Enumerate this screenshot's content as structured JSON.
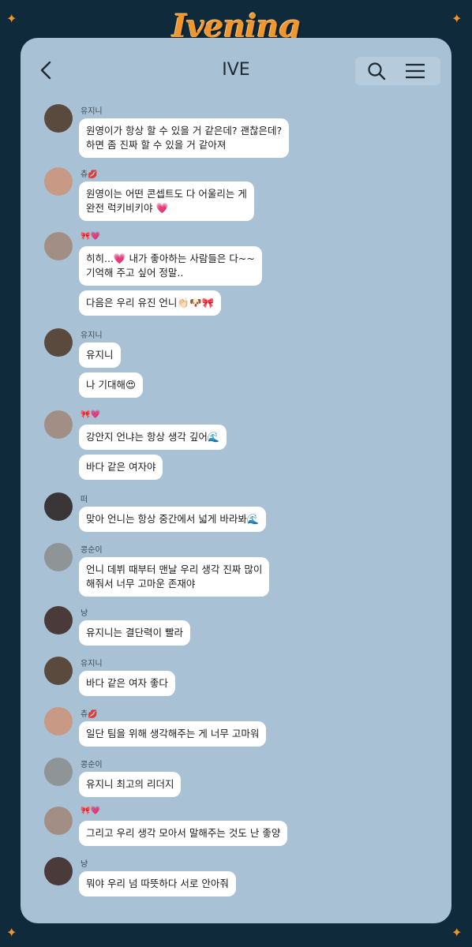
{
  "brand": {
    "logo_text": "Ivening"
  },
  "header": {
    "title": "IVE"
  },
  "icons": {
    "back": "chevron-left-icon",
    "search": "search-icon",
    "menu": "hamburger-menu-icon",
    "sparkle": "four-point-star-icon"
  },
  "colors": {
    "background": "#0f2a3a",
    "panel": "#a8c1d5",
    "accent": "#f0962f",
    "bubble": "#ffffff"
  },
  "messages": [
    {
      "sender": "유지니",
      "avatar_color": "#5a4a3e",
      "lines": [
        "원영이가 항상 할 수 있을 거 같은데? 괜찮은데?",
        "하면 좀 진짜 할 수 있을 거 같아져"
      ]
    },
    {
      "sender": "츄💋",
      "avatar_color": "#c89a86",
      "lines": [
        "원영이는 어떤 콘셉트도 다 어울리는 게",
        "완전 럭키비키야 💗"
      ]
    },
    {
      "sender": "🎀💗",
      "avatar_color": "#a38e86",
      "lines": [
        "히히...💗 내가 좋아하는 사람들은 다~~",
        "기억해 주고 싶어 정말.."
      ],
      "extra": "다음은 우리 유진 언니👏🏻🐶🎀"
    },
    {
      "sender": "유지니",
      "avatar_color": "#5a4a3e",
      "lines": [
        "유지니"
      ],
      "extra": "나 기대해😍"
    },
    {
      "sender": "🎀💗",
      "avatar_color": "#a38e86",
      "lines": [
        "강안지 언냐는 항상 생각 깊어🌊"
      ],
      "extra": "바다 같은 여자야"
    },
    {
      "sender": "떠",
      "avatar_color": "#3a3638",
      "lines": [
        "맞아 언니는 항상 중간에서 넓게 바라봐🌊"
      ]
    },
    {
      "sender": "콩순이",
      "avatar_color": "#8f9496",
      "lines": [
        "언니 데뷔 때부터 맨날 우리 생각 진짜 많이",
        "해줘서 너무 고마운 존재야"
      ]
    },
    {
      "sender": "냥",
      "avatar_color": "#4a3a3a",
      "lines": [
        "유지니는 결단력이 빨라"
      ]
    },
    {
      "sender": "유지니",
      "avatar_color": "#5a4a3e",
      "lines": [
        "바다 같은 여자 좋다"
      ]
    },
    {
      "sender": "츄💋",
      "avatar_color": "#c89a86",
      "lines": [
        "일단 팀을 위해 생각해주는 게 너무 고마워"
      ]
    },
    {
      "sender": "콩순이",
      "avatar_color": "#8f9496",
      "lines": [
        "유지니 최고의 리더지"
      ]
    },
    {
      "sender": "🎀💗",
      "avatar_color": "#a38e86",
      "lines": [
        "그리고 우리 생각 모아서 말해주는 것도 난 좋양"
      ]
    },
    {
      "sender": "냥",
      "avatar_color": "#4a3a3a",
      "lines": [
        "뭐야 우리 넘 따뜻하다 서로 안아줘"
      ]
    }
  ]
}
